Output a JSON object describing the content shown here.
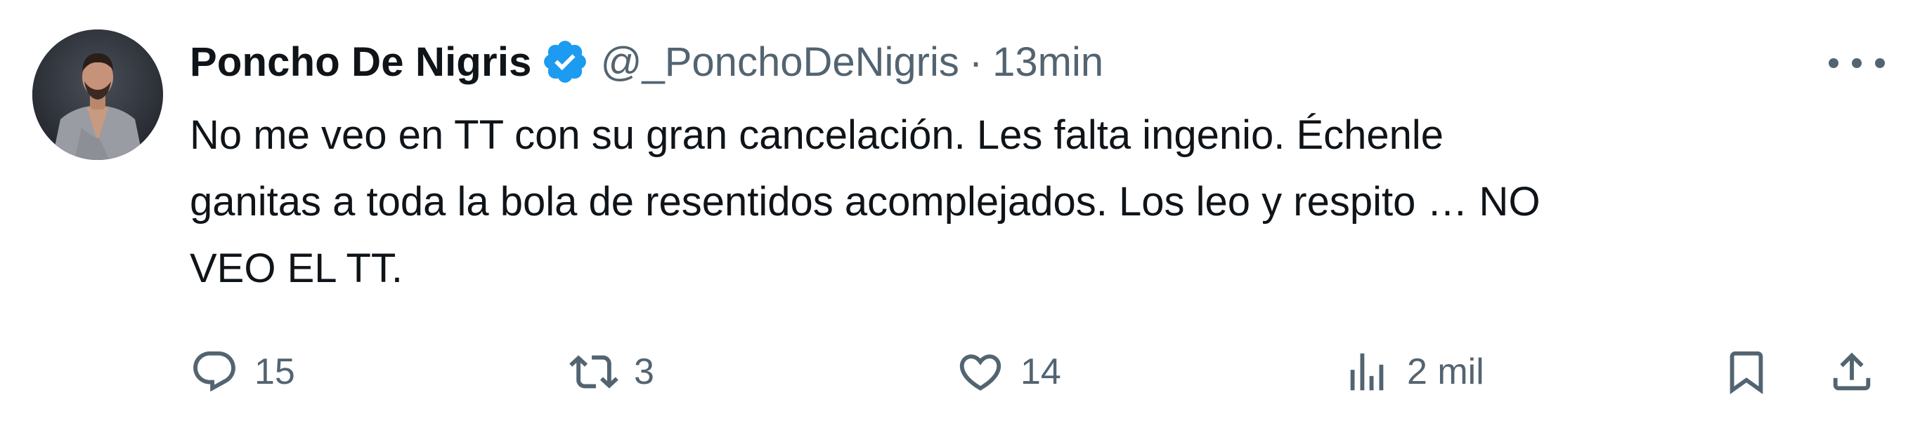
{
  "tweet": {
    "author": {
      "name": "Poncho De Nigris",
      "handle": "@_PonchoDeNigris",
      "verified": true,
      "avatar_icon": "avatar-photo"
    },
    "separator": "·",
    "time": "13min",
    "text_lines": [
      "No me veo en TT con su gran cancelación. Les falta ingenio. Échenle",
      "ganitas a toda la bola de resentidos acomplejados. Los leo y respito … NO",
      "VEO EL TT."
    ],
    "stats": {
      "replies": "15",
      "retweets": "3",
      "likes": "14",
      "views": "2 mil"
    }
  },
  "icons": {
    "verified": "verified-badge-icon",
    "more": "more-options-icon",
    "reply": "reply-icon",
    "retweet": "retweet-icon",
    "like": "heart-icon",
    "views": "views-chart-icon",
    "bookmark": "bookmark-icon",
    "share": "share-icon"
  },
  "colors": {
    "verified_blue": "#1d9bf0",
    "secondary_text": "#536471",
    "primary_text": "#0f1419"
  }
}
